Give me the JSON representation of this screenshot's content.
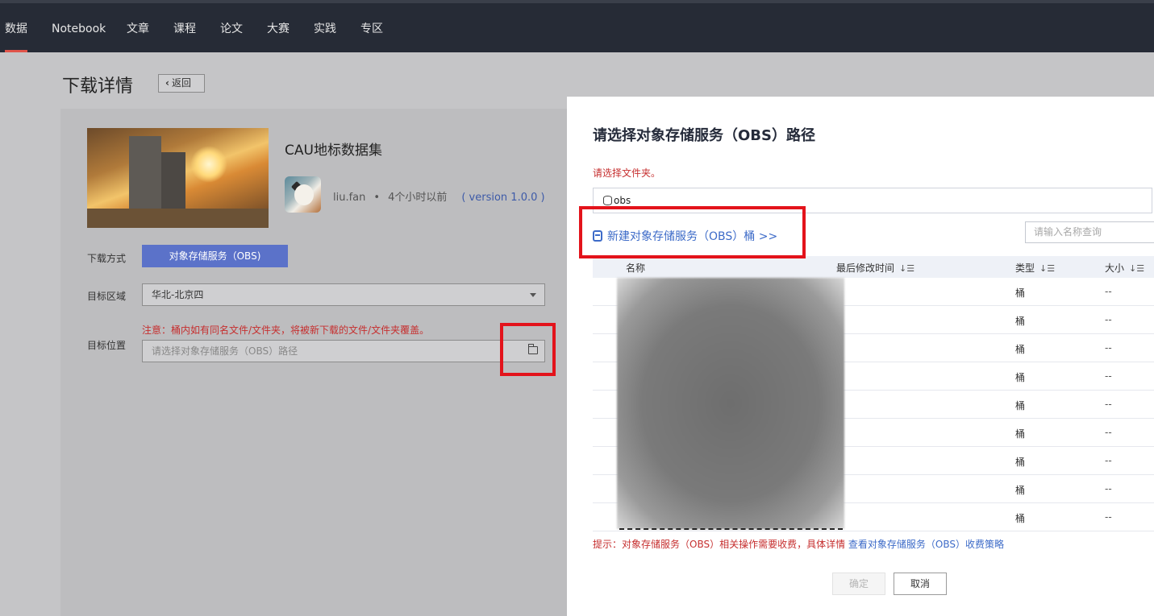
{
  "nav": {
    "items": [
      "数据",
      "Notebook",
      "文章",
      "课程",
      "论文",
      "大赛",
      "实践",
      "专区"
    ]
  },
  "page": {
    "title": "下载详情",
    "back_label": "返回"
  },
  "dataset": {
    "title": "CAU地标数据集",
    "author": "liu.fan",
    "time_ago": "4个小时以前",
    "version": "( version 1.0.0 )"
  },
  "form": {
    "download_method_label": "下载方式",
    "download_method_value": "对象存储服务（OBS)",
    "region_label": "目标区域",
    "region_value": "华北-北京四",
    "location_label": "目标位置",
    "location_warning": "注意：桶内如有同名文件/文件夹，将被新下载的文件/文件夹覆盖。",
    "location_placeholder": "请选择对象存储服务（OBS）路径"
  },
  "dialog": {
    "title": "请选择对象存储服务（OBS）路径",
    "hint": "请选择文件夹。",
    "path_value": "obs",
    "new_bucket_link": "新建对象存储服务（OBS）桶 >>",
    "search_placeholder": "请输入名称查询",
    "columns": {
      "name": "名称",
      "modified": "最后修改时间",
      "type": "类型",
      "size": "大小"
    },
    "rows": [
      {
        "type": "桶",
        "size": "--"
      },
      {
        "type": "桶",
        "size": "--"
      },
      {
        "type": "桶",
        "size": "--"
      },
      {
        "type": "桶",
        "size": "--"
      },
      {
        "type": "桶",
        "size": "--"
      },
      {
        "type": "桶",
        "size": "--"
      },
      {
        "type": "桶",
        "size": "--"
      },
      {
        "type": "桶",
        "size": "--"
      },
      {
        "type": "桶",
        "size": "--"
      }
    ],
    "fee_hint": "提示：对象存储服务（OBS）相关操作需要收费，具体详情",
    "fee_link": "查看对象存储服务（OBS）收费策略",
    "ok_label": "确定",
    "cancel_label": "取消"
  },
  "colors": {
    "nav_bg": "#262b36",
    "accent_red": "#e0544a",
    "obs_button": "#5b72c9",
    "link_blue": "#3d6bc8",
    "warning_red": "#c62f2f",
    "highlight_box": "#e3131b"
  }
}
